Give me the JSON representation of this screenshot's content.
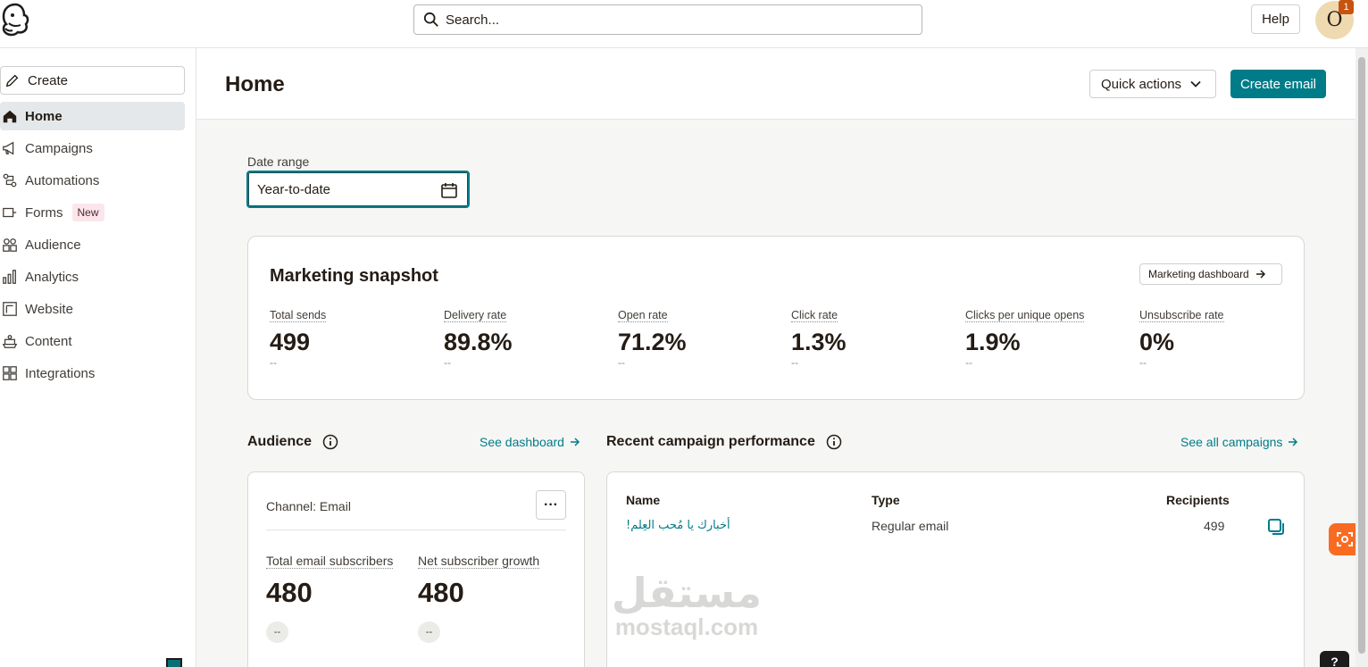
{
  "topbar": {
    "search_placeholder": "Search...",
    "help_label": "Help",
    "avatar_initial": "O",
    "notification_count": "1"
  },
  "sidebar": {
    "create_label": "Create",
    "items": [
      {
        "label": "Home",
        "icon": "home-icon",
        "active": true
      },
      {
        "label": "Campaigns",
        "icon": "megaphone-icon"
      },
      {
        "label": "Automations",
        "icon": "automations-icon"
      },
      {
        "label": "Forms",
        "icon": "forms-icon",
        "badge": "New"
      },
      {
        "label": "Audience",
        "icon": "audience-icon"
      },
      {
        "label": "Analytics",
        "icon": "bar-chart-icon"
      },
      {
        "label": "Website",
        "icon": "website-icon"
      },
      {
        "label": "Content",
        "icon": "content-icon"
      },
      {
        "label": "Integrations",
        "icon": "grid-icon"
      }
    ]
  },
  "header": {
    "title": "Home",
    "quick_actions_label": "Quick actions",
    "create_email_label": "Create email"
  },
  "date_range": {
    "label": "Date range",
    "value": "Year-to-date"
  },
  "snapshot": {
    "title": "Marketing snapshot",
    "dashboard_link": "Marketing dashboard",
    "metrics": [
      {
        "label": "Total sends",
        "value": "499",
        "change": "--"
      },
      {
        "label": "Delivery rate",
        "value": "89.8%",
        "change": "--"
      },
      {
        "label": "Open rate",
        "value": "71.2%",
        "change": "--"
      },
      {
        "label": "Click rate",
        "value": "1.3%",
        "change": "--"
      },
      {
        "label": "Clicks per unique opens",
        "value": "1.9%",
        "change": "--"
      },
      {
        "label": "Unsubscribe rate",
        "value": "0%",
        "change": "--"
      }
    ]
  },
  "audience": {
    "title": "Audience",
    "link": "See dashboard",
    "channel": "Channel: Email",
    "more_label": "···",
    "metrics": [
      {
        "label": "Total email subscribers",
        "value": "480",
        "change": "--"
      },
      {
        "label": "Net subscriber growth",
        "value": "480",
        "change": "--"
      }
    ]
  },
  "campaigns": {
    "title": "Recent campaign performance",
    "link": "See all campaigns",
    "columns": [
      "Name",
      "Type",
      "Recipients"
    ],
    "rows": [
      {
        "name": "أخبارك يا مُحب العِلم!",
        "type": "Regular email",
        "recipients": "499"
      }
    ]
  },
  "watermark": {
    "arabic": "مستقل",
    "latin": "mostaql.com"
  },
  "floating": {
    "help_label": "?"
  },
  "colors": {
    "accent": "#007c89",
    "badge_orange": "#c6540f",
    "floating_orange": "#fa6b22"
  }
}
